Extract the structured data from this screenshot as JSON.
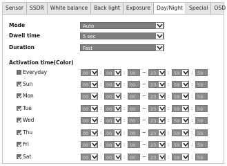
{
  "tabs": [
    "Sensor",
    "SSDR",
    "White balance",
    "Back light",
    "Exposure",
    "Day/Night",
    "Special",
    "OSD"
  ],
  "active_tab": "Day/Night",
  "fields": {
    "mode": {
      "label": "Mode",
      "value": "Auto"
    },
    "dwell": {
      "label": "Dwell time",
      "value": "5 sec"
    },
    "duration": {
      "label": "Duration",
      "value": "Fast"
    }
  },
  "activation_title": "Activation time(Color)",
  "days": [
    {
      "label": "Everyday",
      "checked": false,
      "start_h": "00",
      "start_m": "00",
      "start_s": "00",
      "end_h": "23",
      "end_m": "59",
      "end_s": "59"
    },
    {
      "label": "Sun",
      "checked": true,
      "start_h": "00",
      "start_m": "00",
      "start_s": "00",
      "end_h": "23",
      "end_m": "59",
      "end_s": "59"
    },
    {
      "label": "Mon",
      "checked": true,
      "start_h": "00",
      "start_m": "00",
      "start_s": "00",
      "end_h": "23",
      "end_m": "59",
      "end_s": "59"
    },
    {
      "label": "Tue",
      "checked": true,
      "start_h": "00",
      "start_m": "00",
      "start_s": "00",
      "end_h": "23",
      "end_m": "59",
      "end_s": "59"
    },
    {
      "label": "Wed",
      "checked": true,
      "start_h": "00",
      "start_m": "00",
      "start_s": "00",
      "end_h": "23",
      "end_m": "59",
      "end_s": "59"
    },
    {
      "label": "Thu",
      "checked": true,
      "start_h": "00",
      "start_m": "00",
      "start_s": "00",
      "end_h": "23",
      "end_m": "59",
      "end_s": "59"
    },
    {
      "label": "Fri",
      "checked": true,
      "start_h": "00",
      "start_m": "00",
      "start_s": "00",
      "end_h": "23",
      "end_m": "59",
      "end_s": "59"
    },
    {
      "label": "Sat",
      "checked": true,
      "start_h": "00",
      "start_m": "00",
      "start_s": "00",
      "end_h": "23",
      "end_m": "59",
      "end_s": "59"
    }
  ],
  "separators": {
    "colon": ":",
    "tilde": "~"
  },
  "colors": {
    "select_bg": "#7d7d7d",
    "tab_bg": "#e6e6e6",
    "active_tab_bg": "#ffffff"
  }
}
